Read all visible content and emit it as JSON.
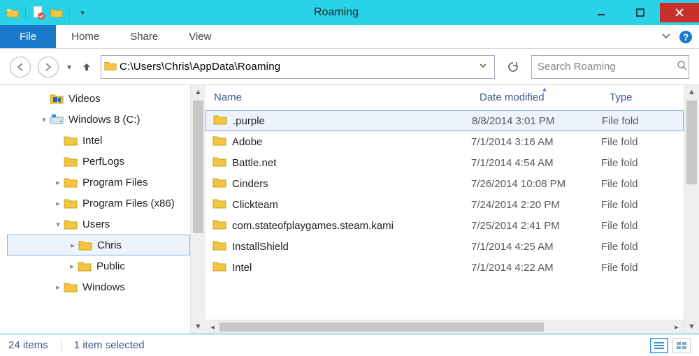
{
  "window": {
    "title": "Roaming"
  },
  "ribbon": {
    "file": "File",
    "tabs": [
      "Home",
      "Share",
      "View"
    ]
  },
  "nav": {
    "address": "C:\\Users\\Chris\\AppData\\Roaming",
    "search_placeholder": "Search Roaming"
  },
  "tree": {
    "items": [
      {
        "label": "Videos",
        "indent": 0,
        "icon": "videos"
      },
      {
        "label": "Windows 8 (C:)",
        "indent": 0,
        "icon": "drive",
        "expanded": true
      },
      {
        "label": "Intel",
        "indent": 1,
        "icon": "folder"
      },
      {
        "label": "PerfLogs",
        "indent": 1,
        "icon": "folder"
      },
      {
        "label": "Program Files",
        "indent": 1,
        "icon": "folder",
        "expander": true
      },
      {
        "label": "Program Files (x86)",
        "indent": 1,
        "icon": "folder",
        "expander": true
      },
      {
        "label": "Users",
        "indent": 1,
        "icon": "folder",
        "expanded": true
      },
      {
        "label": "Chris",
        "indent": 2,
        "icon": "folder",
        "expander": true,
        "selected": true
      },
      {
        "label": "Public",
        "indent": 2,
        "icon": "folder",
        "expander": true
      },
      {
        "label": "Windows",
        "indent": 1,
        "icon": "folder",
        "expander": true
      }
    ]
  },
  "columns": {
    "name": "Name",
    "date": "Date modified",
    "type": "Type"
  },
  "rows": [
    {
      "name": ".purple",
      "date": "8/8/2014 3:01 PM",
      "type": "File fold",
      "selected": true
    },
    {
      "name": "Adobe",
      "date": "7/1/2014 3:16 AM",
      "type": "File fold"
    },
    {
      "name": "Battle.net",
      "date": "7/1/2014 4:54 AM",
      "type": "File fold"
    },
    {
      "name": "Cinders",
      "date": "7/26/2014 10:08 PM",
      "type": "File fold"
    },
    {
      "name": "Clickteam",
      "date": "7/24/2014 2:20 PM",
      "type": "File fold"
    },
    {
      "name": "com.stateofplaygames.steam.kami",
      "date": "7/25/2014 2:41 PM",
      "type": "File fold"
    },
    {
      "name": "InstallShield",
      "date": "7/1/2014 4:25 AM",
      "type": "File fold"
    },
    {
      "name": "Intel",
      "date": "7/1/2014 4:22 AM",
      "type": "File fold"
    }
  ],
  "status": {
    "count": "24 items",
    "selection": "1 item selected"
  }
}
